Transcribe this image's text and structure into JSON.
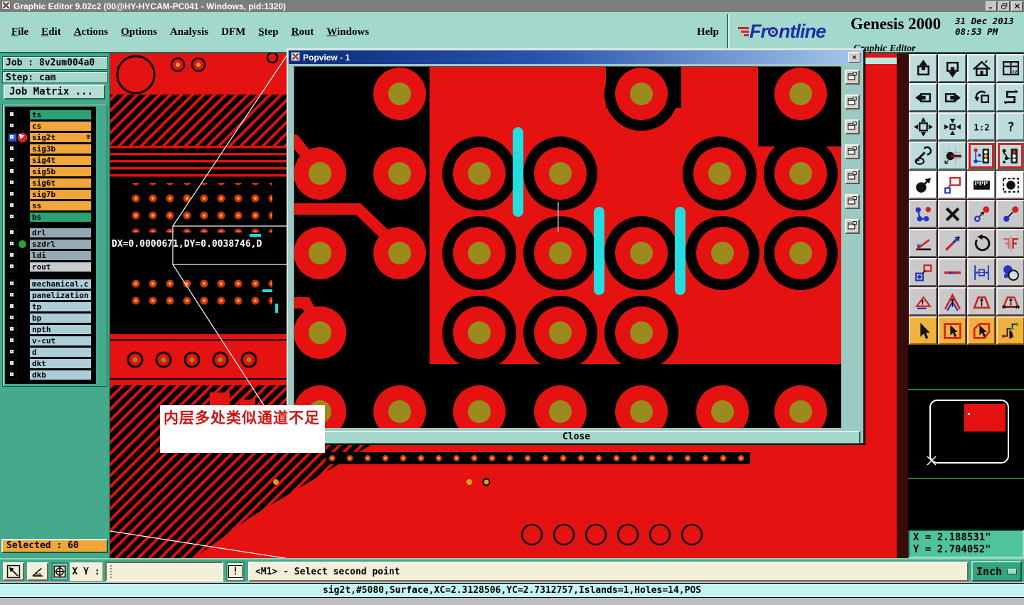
{
  "window": {
    "title": "Graphic Editor 9.02c2 (00@HY-HYCAM-PC041 - Windows, pid:1320)",
    "controls": [
      {
        "name": "minimize-button",
        "icon": "win-min"
      },
      {
        "name": "restore-button",
        "icon": "win-restore"
      },
      {
        "name": "close-button",
        "icon": "win-close"
      }
    ]
  },
  "menu_bar": {
    "items": [
      {
        "label": "File",
        "underline": "F"
      },
      {
        "label": "Edit",
        "underline": "E"
      },
      {
        "label": "Actions",
        "underline": "A"
      },
      {
        "label": "Options",
        "underline": "O"
      },
      {
        "label": "Analysis",
        "underline": ""
      },
      {
        "label": "DFM",
        "underline": ""
      },
      {
        "label": "Step",
        "underline": "S"
      },
      {
        "label": "Rout",
        "underline": "R"
      },
      {
        "label": "Windows",
        "underline": "W"
      }
    ],
    "help_label": "Help"
  },
  "brand": {
    "logo_text": "Frontline",
    "product": "Genesis 2000",
    "date": "31 Dec 2013",
    "time": "08:53 PM",
    "subtitle": "Graphic Editor"
  },
  "left_panel": {
    "job_label": "Job : 8v2um004a0",
    "step_label": "Step: cam",
    "job_matrix_button": "Job Matrix ...",
    "selected_label": "Selected : 60",
    "layer_groups": [
      [
        {
          "name": "ts",
          "color": "#2ba276",
          "active": false
        },
        {
          "name": "cs",
          "color": "#f1a63a",
          "active": false
        },
        {
          "name": "sig2t",
          "color": "#f1a63a",
          "active": true,
          "badge": "work-arrow",
          "expand": true
        },
        {
          "name": "sig3b",
          "color": "#f1a63a",
          "active": false
        },
        {
          "name": "sig4t",
          "color": "#f1a63a",
          "active": false
        },
        {
          "name": "sig5b",
          "color": "#f1a63a",
          "active": false
        },
        {
          "name": "sig6t",
          "color": "#f1a63a",
          "active": false
        },
        {
          "name": "sig7b",
          "color": "#f1a63a",
          "active": false
        },
        {
          "name": "ss",
          "color": "#f1a63a",
          "active": false
        },
        {
          "name": "bs",
          "color": "#2ba276",
          "active": false
        }
      ],
      [
        {
          "name": "drl",
          "color": "#94a9b3",
          "active": false
        },
        {
          "name": "szdrl",
          "color": "#94a9b3",
          "active": false,
          "badge": "green-dot"
        },
        {
          "name": "ldi",
          "color": "#94a9b3",
          "active": false
        },
        {
          "name": "rout",
          "color": "#c7cdcf",
          "active": false
        }
      ],
      [
        {
          "name": "mechanical.c",
          "color": "#abced8",
          "active": false
        },
        {
          "name": "panelization",
          "color": "#abced8",
          "active": false
        },
        {
          "name": "tp",
          "color": "#abced8",
          "active": false
        },
        {
          "name": "bp",
          "color": "#abced8",
          "active": false
        },
        {
          "name": "npth",
          "color": "#abced8",
          "active": false
        },
        {
          "name": "v-cut",
          "color": "#abced8",
          "active": false
        },
        {
          "name": "d",
          "color": "#abced8",
          "active": false
        },
        {
          "name": "dkt",
          "color": "#abced8",
          "active": false
        },
        {
          "name": "dkb",
          "color": "#abced8",
          "active": false
        }
      ]
    ]
  },
  "popview": {
    "title": "Popview - 1",
    "close_button": "Close",
    "side_buttons": [
      "popview-tool-button-1",
      "popview-tool-button-2",
      "popview-tool-button-3",
      "popview-tool-button-4",
      "popview-tool-button-5",
      "popview-tool-button-6",
      "popview-tool-button-7"
    ]
  },
  "canvas": {
    "dx_readout": "DX=0.0000671,DY=0.0038746,D",
    "annotation": "内层多处类似通道不足"
  },
  "right_toolbar": {
    "buttons": [
      {
        "name": "zoom-in-view-button",
        "icon": "box-up",
        "style": "std"
      },
      {
        "name": "zoom-out-view-button",
        "icon": "box-down",
        "style": "std"
      },
      {
        "name": "home-view-button",
        "icon": "home",
        "style": "std"
      },
      {
        "name": "window-xy-button",
        "icon": "window-xy",
        "style": "std"
      },
      {
        "name": "pan-left-button",
        "icon": "box-left",
        "style": "std"
      },
      {
        "name": "pan-right-button",
        "icon": "box-right",
        "style": "std"
      },
      {
        "name": "previous-view-button",
        "icon": "undo-box",
        "style": "std"
      },
      {
        "name": "serpentine-view-button",
        "icon": "s-shape",
        "style": "std"
      },
      {
        "name": "fit-view-button",
        "icon": "fit-arrows",
        "style": "std"
      },
      {
        "name": "center-view-button",
        "icon": "center-arrows",
        "style": "std"
      },
      {
        "name": "scale-1-2-button",
        "icon": "one-two",
        "style": "std"
      },
      {
        "name": "query-button",
        "icon": "question",
        "style": "std"
      },
      {
        "name": "setup-tools-button",
        "icon": "tools",
        "style": "std"
      },
      {
        "name": "measure-point-button",
        "icon": "measure-dot",
        "style": "std"
      },
      {
        "name": "datum-lights-blue-button",
        "icon": "traffic-blue",
        "style": "std red-frame"
      },
      {
        "name": "datum-lights-red-button",
        "icon": "traffic-red",
        "style": "std red-frame"
      },
      {
        "name": "move-feature-button",
        "icon": "move-circle",
        "style": "white"
      },
      {
        "name": "copy-feature-button",
        "icon": "copy-outline",
        "style": "white"
      },
      {
        "name": "ruler-button",
        "icon": "ruler",
        "style": "white"
      },
      {
        "name": "select-feature-button",
        "icon": "select-dashed",
        "style": "white"
      },
      {
        "name": "polyline-button",
        "icon": "chain-dots",
        "style": "gray"
      },
      {
        "name": "delete-button",
        "icon": "delete-x",
        "style": "gray"
      },
      {
        "name": "resize-button",
        "icon": "grow-dot",
        "style": "gray"
      },
      {
        "name": "move-point-button",
        "icon": "move-dot",
        "style": "gray"
      },
      {
        "name": "rotate-angle-button",
        "icon": "angle-line",
        "style": "gray"
      },
      {
        "name": "slant-line-button",
        "icon": "slope-line",
        "style": "gray"
      },
      {
        "name": "rotate-button",
        "icon": "rotate-cw",
        "style": "gray"
      },
      {
        "name": "mirror-button",
        "icon": "mirror-ff",
        "style": "gray"
      },
      {
        "name": "copy-pad-button",
        "icon": "copy-pad",
        "style": "gray"
      },
      {
        "name": "break-line-button",
        "icon": "break-line",
        "style": "gray"
      },
      {
        "name": "measure-gap-button",
        "icon": "measure-gap",
        "style": "gray"
      },
      {
        "name": "touchup-button",
        "icon": "touchup",
        "style": "gray"
      },
      {
        "name": "surface-mode-1-button",
        "icon": "tri-1",
        "style": "gray"
      },
      {
        "name": "surface-mode-2-button",
        "icon": "tri-2",
        "style": "gray"
      },
      {
        "name": "surface-mode-3-button",
        "icon": "tri-3",
        "style": "gray"
      },
      {
        "name": "surface-mode-4-button",
        "icon": "tri-4",
        "style": "gray"
      },
      {
        "name": "select-pointer-button",
        "icon": "select-arrow",
        "style": "orange"
      },
      {
        "name": "select-frame-button",
        "icon": "select-frame",
        "style": "orange"
      },
      {
        "name": "select-polygon-button",
        "icon": "select-poly",
        "style": "orange"
      },
      {
        "name": "select-net-button",
        "icon": "select-net",
        "style": "orange"
      }
    ]
  },
  "overview": {
    "x_readout": "X = 2.188531\"",
    "y_readout": "Y = 2.704052\""
  },
  "bottom_bar": {
    "icon_buttons": [
      {
        "name": "zoom-window-button",
        "icon": "diag-arrow",
        "selected": false
      },
      {
        "name": "angle-measure-button",
        "icon": "angle",
        "selected": false
      },
      {
        "name": "quadrant-view-button",
        "icon": "quadrant",
        "selected": true
      }
    ],
    "xy_label": "X Y :",
    "xy_value": "",
    "alert_button": "!",
    "prompt": "<M1> - Select second point",
    "units_button": "Inch"
  },
  "status_bar": {
    "text": "sig2t,#5080,Surface,XC=2.3128506,YC=2.7312757,Islands=1,Holes=14,POS"
  },
  "colors": {
    "board_red": "#e51212",
    "pad_center_olive": "#9a8b1e",
    "highlight_cyan": "#22dede",
    "panel_teal": "#45a98b",
    "menu_teal": "#a3d8cd",
    "cream": "#f3efda",
    "layer_orange": "#f1a63a"
  }
}
